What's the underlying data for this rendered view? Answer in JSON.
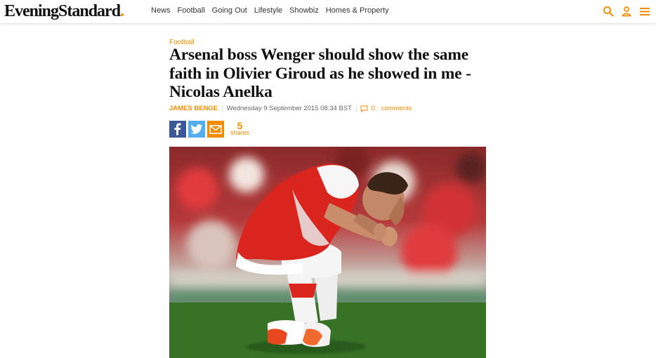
{
  "header": {
    "logo_text": "EveningStandard",
    "logo_dot": ".",
    "nav": [
      "News",
      "Football",
      "Going Out",
      "Lifestyle",
      "Showbiz",
      "Homes & Property"
    ],
    "icons": [
      "search-icon",
      "user-icon",
      "menu-icon"
    ]
  },
  "article": {
    "section": "Football",
    "headline": "Arsenal boss Wenger should show the same faith in Olivier Giroud as he showed in me - Nicolas Anelka",
    "author": "JAMES BENGE",
    "date": "Wednesday 9 September 2015 08:34 BST",
    "comments_count": "0",
    "comments_label": "comments",
    "share_count": "5",
    "share_label": "shares"
  },
  "colors": {
    "accent": "#f28c00",
    "facebook": "#3b5998",
    "twitter": "#55acee",
    "kit_red": "#d9251d"
  }
}
